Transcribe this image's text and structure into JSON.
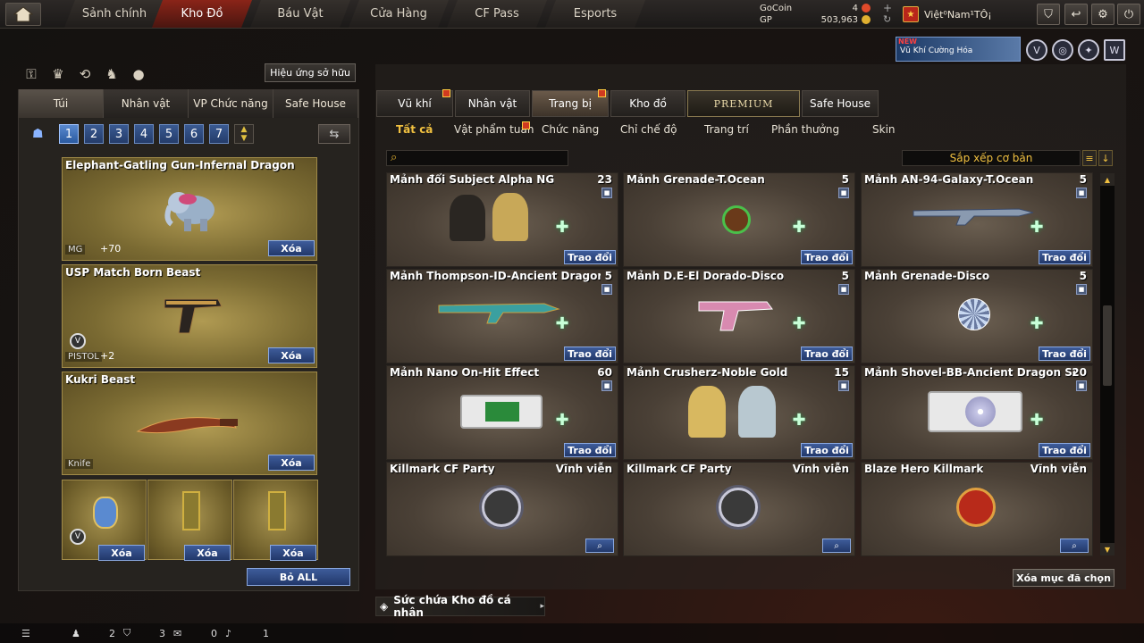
{
  "nav": {
    "tabs": [
      {
        "label": "Sảnh chính"
      },
      {
        "label": "Kho Đồ"
      },
      {
        "label": "Báu Vật"
      },
      {
        "label": "Cửa Hàng"
      },
      {
        "label": "CF Pass"
      },
      {
        "label": "Esports"
      }
    ],
    "active_tab": "Kho Đồ"
  },
  "currency": {
    "gocoin_label": "GoCoin",
    "gocoin_value": "4",
    "gp_label": "GP",
    "gp_value": "503,963"
  },
  "player": {
    "name": "Việt⁰Nam¹TÔ¡"
  },
  "promo": {
    "new_tag": "NEW",
    "title": "Vũ Khí Cường Hóa"
  },
  "left": {
    "effect_button": "Hiệu ứng sở hữu",
    "tabs": [
      "Túi",
      "Nhân vật",
      "VP Chức năng",
      "Safe House"
    ],
    "pages": [
      "1",
      "2",
      "3",
      "4",
      "5",
      "6",
      "7"
    ],
    "active_page": "1",
    "equipped": [
      {
        "name": "Elephant-Gatling Gun-Infernal Dragon",
        "type": "MG",
        "bonus": "+70",
        "action": "Xóa"
      },
      {
        "name": "USP Match Born Beast",
        "type": "PISTOL",
        "bonus": "+2",
        "action": "Xóa"
      },
      {
        "name": "Kukri Beast",
        "type": "Knife",
        "bonus": "",
        "action": "Xóa"
      }
    ],
    "small_slots": [
      {
        "action": "Xóa"
      },
      {
        "action": "Xóa"
      },
      {
        "action": "Xóa"
      }
    ],
    "remove_all": "Bỏ ALL"
  },
  "right": {
    "tabs": [
      "Vũ khí",
      "Nhân vật",
      "Trang bị",
      "Kho đồ",
      "PREMIUM",
      "Safe House"
    ],
    "active_tab": "Trang bị",
    "subtabs": [
      "Tất cả",
      "Vật phẩm tuần",
      "Chức năng",
      "Chỉ chế độ",
      "Trang trí",
      "Phần thưởng",
      "Skin"
    ],
    "active_subtab": "Tất cả",
    "search_placeholder": "",
    "sort_label": "Sắp xếp cơ bản",
    "items": [
      {
        "name": "Mảnh đổi Subject Alpha NG",
        "qty": "23",
        "action": "Trao đổi"
      },
      {
        "name": "Mảnh Grenade-T.Ocean",
        "qty": "5",
        "action": "Trao đổi"
      },
      {
        "name": "Mảnh AN-94-Galaxy-T.Ocean",
        "qty": "5",
        "action": "Trao đổi"
      },
      {
        "name": "Mảnh Thompson-ID-Ancient Dragon",
        "qty": "5",
        "action": "Trao đổi"
      },
      {
        "name": "Mảnh D.E-El Dorado-Disco",
        "qty": "5",
        "action": "Trao đổi"
      },
      {
        "name": "Mảnh Grenade-Disco",
        "qty": "5",
        "action": "Trao đổi"
      },
      {
        "name": "Mảnh Nano On-Hit Effect",
        "qty": "60",
        "action": "Trao đổi"
      },
      {
        "name": "Mảnh Crusherz-Noble Gold",
        "qty": "15",
        "action": "Trao đổi"
      },
      {
        "name": "Mảnh Shovel-BB-Ancient Dragon Sound",
        "qty": "20",
        "action": "Trao đổi"
      },
      {
        "name": "Killmark CF Party",
        "qty": "Vĩnh viễn",
        "action": ""
      },
      {
        "name": "Killmark CF Party",
        "qty": "Vĩnh viễn",
        "action": ""
      },
      {
        "name": "Blaze Hero Killmark",
        "qty": "Vĩnh viễn",
        "action": ""
      }
    ],
    "delete_selected": "Xóa mục đã chọn",
    "capacity_label": "Sức chứa Kho đồ cá nhân"
  },
  "status": {
    "count_a": "2",
    "count_b": "3",
    "count_c": "0",
    "count_d": "1"
  },
  "colors": {
    "accent_gold": "#f0c040",
    "button_blue": "#2a4a86",
    "active_nav_red": "#8a2418"
  }
}
